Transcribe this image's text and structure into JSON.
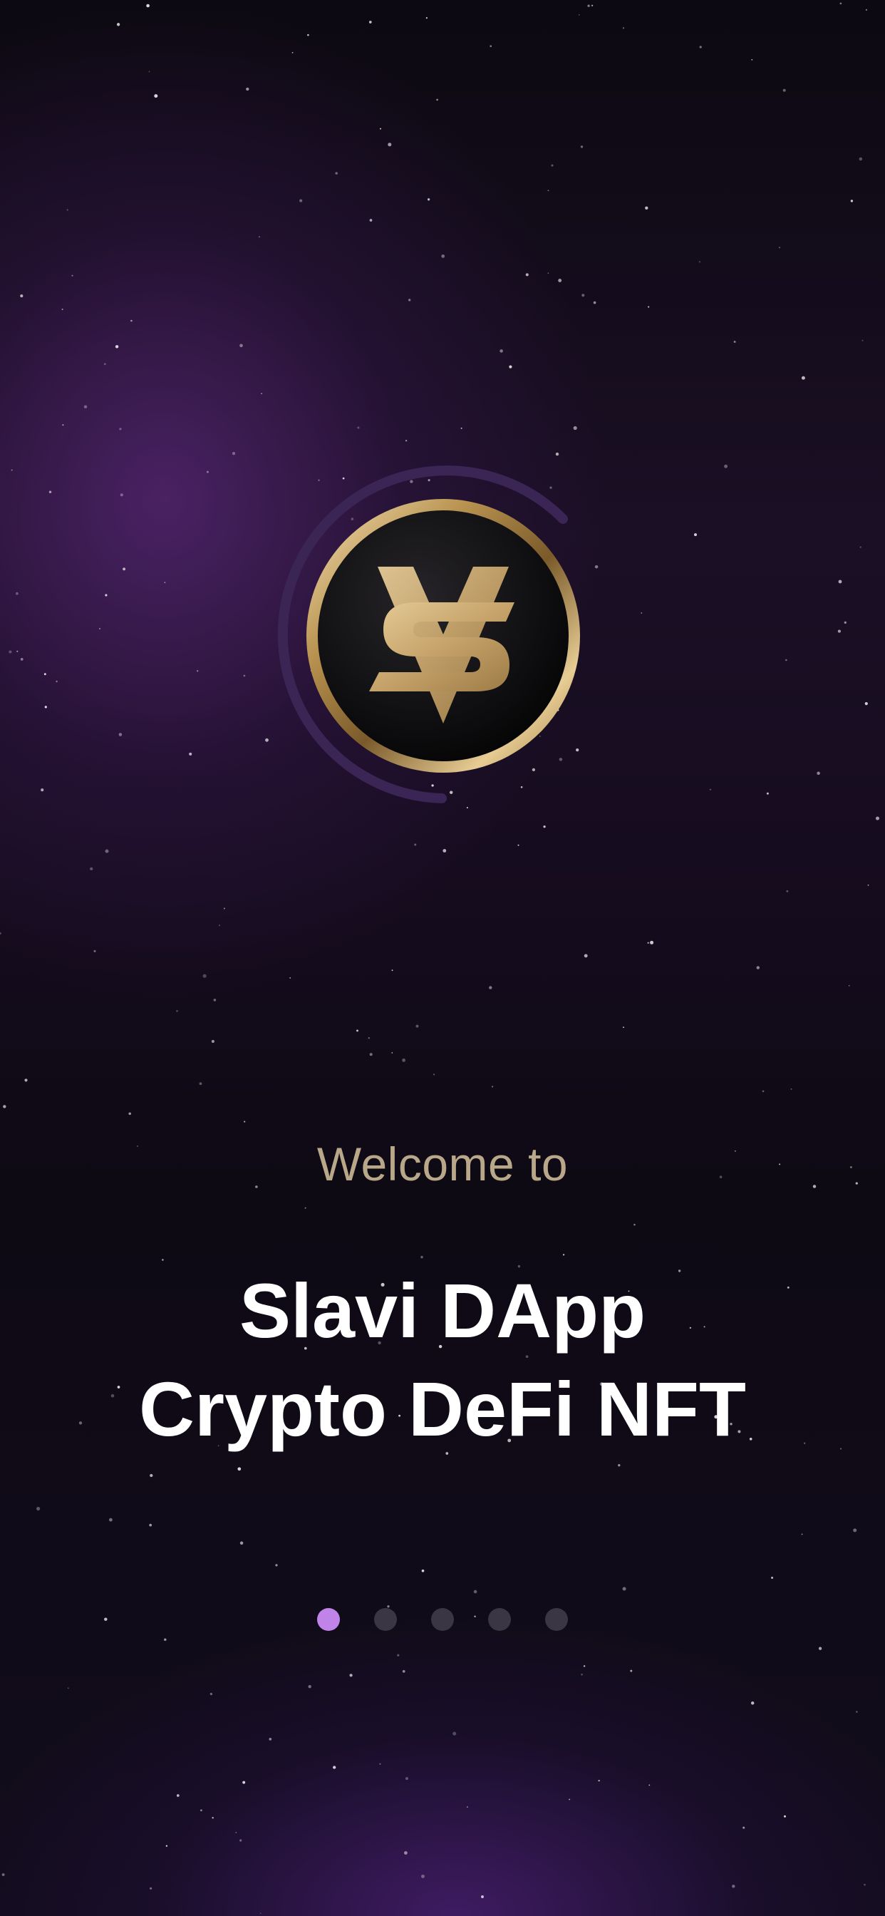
{
  "welcome": {
    "subtitle": "Welcome to",
    "title_line1": "Slavi DApp",
    "title_line2": "Crypto DeFi NFT"
  },
  "logo": {
    "icon": "slavi-logo-icon",
    "gold": "#d9b982",
    "ring_accent": "#3a2555"
  },
  "pagination": {
    "count": 5,
    "active_index": 0,
    "active_color": "#c084e8",
    "inactive_color": "#3a3643"
  },
  "colors": {
    "welcome_text": "#b8a889",
    "title_text": "#ffffff"
  }
}
